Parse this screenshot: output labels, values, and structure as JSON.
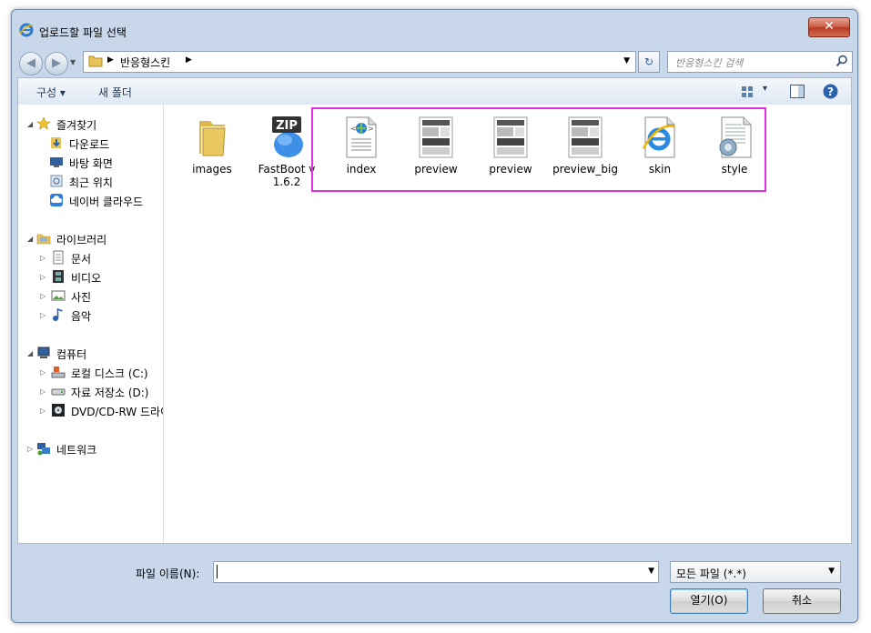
{
  "window": {
    "title": "업로드할 파일 선택",
    "close_label": "✕"
  },
  "nav": {
    "back_glyph": "◀",
    "forward_glyph": "▶",
    "breadcrumb": [
      "반응형스킨"
    ],
    "refresh_glyph": "↻"
  },
  "search": {
    "placeholder": "반응형스킨 검색"
  },
  "toolbar": {
    "organize_label": "구성 ▾",
    "new_folder_label": "새 폴더",
    "view_dd": "▾"
  },
  "sidebar": {
    "favorites": {
      "label": "즐겨찾기",
      "items": [
        "다운로드",
        "바탕 화면",
        "최근 위치",
        "네이버 클라우드"
      ]
    },
    "libraries": {
      "label": "라이브러리",
      "items": [
        "문서",
        "비디오",
        "사진",
        "음악"
      ]
    },
    "computer": {
      "label": "컴퓨터",
      "items": [
        "로컬 디스크 (C:)",
        "자료 저장소 (D:)",
        "DVD/CD-RW 드라이"
      ]
    },
    "network": {
      "label": "네트워크"
    }
  },
  "files": [
    {
      "name": "images",
      "icon": "folder-icon"
    },
    {
      "name": "FastBoot v1.6.2",
      "icon": "zip-icon",
      "badge": "ZIP"
    },
    {
      "name": "index",
      "icon": "html-file-icon"
    },
    {
      "name": "preview",
      "icon": "image-thumbnail-icon"
    },
    {
      "name": "preview",
      "icon": "image-thumbnail-icon"
    },
    {
      "name": "preview_big",
      "icon": "image-thumbnail-icon"
    },
    {
      "name": "skin",
      "icon": "ie-file-icon"
    },
    {
      "name": "style",
      "icon": "css-file-icon"
    }
  ],
  "bottom": {
    "filename_label": "파일 이름(N):",
    "filename_value": "",
    "filetype_value": "모든 파일 (*.*)",
    "open_label": "열기(O)",
    "cancel_label": "취소"
  },
  "colors": {
    "highlight": "#e030e0",
    "close": "#c75a44"
  }
}
